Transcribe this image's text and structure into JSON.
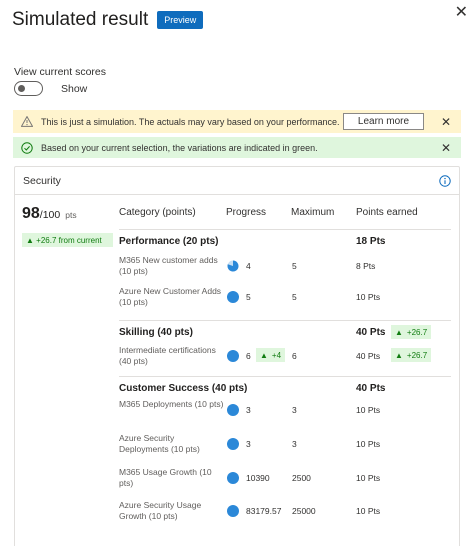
{
  "header": {
    "title": "Simulated result",
    "badge": "Preview"
  },
  "view_scores": {
    "label": "View current scores",
    "toggle_label": "Show",
    "toggle_on": false
  },
  "banners": {
    "warning": {
      "text": "This is just a simulation. The actuals may vary based on your performance.",
      "button": "Learn more"
    },
    "success": {
      "text": "Based on your current selection, the variations are indicated in green."
    }
  },
  "card": {
    "title": "Security",
    "score": {
      "value": "98",
      "total": "/100",
      "unit": "pts",
      "delta": "+26.7 from current"
    },
    "columns": {
      "category": "Category (points)",
      "progress": "Progress",
      "maximum": "Maximum",
      "earned": "Points earned"
    },
    "sections": [
      {
        "title": "Performance (20 pts)",
        "points": "18 Pts",
        "delta": "",
        "rows": [
          {
            "name": "M365 New customer adds (10 pts)",
            "progress": "4",
            "progress_fraction": 0.8,
            "progress_delta": "",
            "max": "5",
            "points": "8 Pts",
            "points_delta": ""
          },
          {
            "name": "Azure New Customer Adds (10 pts)",
            "progress": "5",
            "progress_fraction": 1.0,
            "progress_delta": "",
            "max": "5",
            "points": "10 Pts",
            "points_delta": ""
          }
        ]
      },
      {
        "title": "Skilling (40 pts)",
        "points": "40 Pts",
        "delta": "+26.7",
        "rows": [
          {
            "name": "Intermediate certifications (40 pts)",
            "progress": "6",
            "progress_fraction": 1.0,
            "progress_delta": "+4",
            "max": "6",
            "points": "40 Pts",
            "points_delta": "+26.7"
          }
        ]
      },
      {
        "title": "Customer Success (40 pts)",
        "points": "40 Pts",
        "delta": "",
        "rows": [
          {
            "name": "M365 Deployments (10 pts)",
            "progress": "3",
            "progress_fraction": 1.0,
            "progress_delta": "",
            "max": "3",
            "points": "10 Pts",
            "points_delta": ""
          },
          {
            "name": "Azure Security Deployments (10 pts)",
            "progress": "3",
            "progress_fraction": 1.0,
            "progress_delta": "",
            "max": "3",
            "points": "10 Pts",
            "points_delta": ""
          },
          {
            "name": "M365 Usage Growth (10 pts)",
            "progress": "10390",
            "progress_fraction": 1.0,
            "progress_delta": "",
            "max": "2500",
            "points": "10 Pts",
            "points_delta": ""
          },
          {
            "name": "Azure Security Usage Growth (10 pts)",
            "progress": "83179.57",
            "progress_fraction": 1.0,
            "progress_delta": "",
            "max": "25000",
            "points": "10 Pts",
            "points_delta": ""
          }
        ]
      }
    ]
  },
  "colors": {
    "accent": "#0f6cbd",
    "progress": "#2b88d8",
    "warning_bg": "#fff4ce",
    "success_bg": "#dff6dd",
    "success_text": "#107c10"
  }
}
